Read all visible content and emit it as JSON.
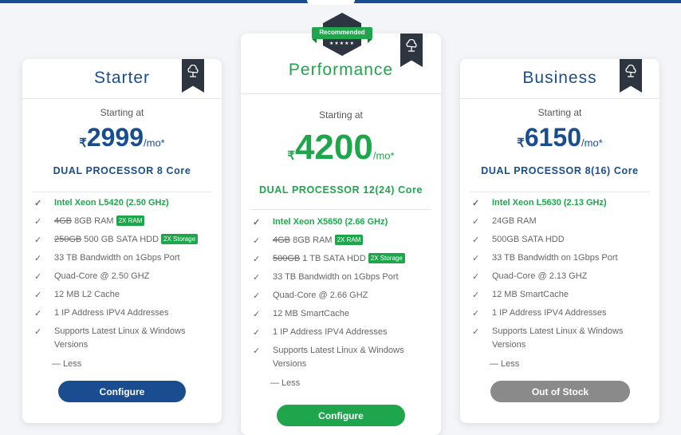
{
  "plans": [
    {
      "title": "Starter",
      "starting": "Starting at",
      "currency": "₹",
      "price": "2999",
      "per": "/mo*",
      "processor": "DUAL PROCESSOR 8 Core",
      "cpu": "Intel Xeon L5420 (2.50 GHz)",
      "ram_old": "4GB",
      "ram_new": " 8GB RAM",
      "ram_badge": "2X RAM",
      "hdd_old": "250GB",
      "hdd_new": " 500 GB SATA HDD",
      "hdd_badge": "2X Storage",
      "bandwidth": "33 TB Bandwidth on 1Gbps Port",
      "cores": "Quad-Core @ 2.50 GHZ",
      "cache": "12 MB L2 Cache",
      "ip": "1 IP Address IPV4 Addresses",
      "os": "Supports Latest Linux & Windows Versions",
      "less": "— Less",
      "button": "Configure"
    },
    {
      "title": "Performance",
      "starting": "Starting at",
      "currency": "₹",
      "price": "4200",
      "per": "/mo*",
      "processor": "DUAL PROCESSOR 12(24) Core",
      "cpu": "Intel Xeon X5650 (2.66 GHz)",
      "ram_old": "4GB",
      "ram_new": " 8GB RAM",
      "ram_badge": "2X RAM",
      "hdd_old": "500GB",
      "hdd_new": " 1 TB SATA HDD",
      "hdd_badge": "2X Storage",
      "bandwidth": "33 TB Bandwidth on 1Gbps Port",
      "cores": "Quad-Core @ 2.66 GHZ",
      "cache": "12 MB SmartCache",
      "ip": "1 IP Address IPV4 Addresses",
      "os": "Supports Latest Linux & Windows Versions",
      "less": "— Less",
      "button": "Configure",
      "recommended": "Recommended",
      "stars": "★★★★★"
    },
    {
      "title": "Business",
      "starting": "Starting at",
      "currency": "₹",
      "price": "6150",
      "per": "/mo*",
      "processor": "DUAL PROCESSOR 8(16) Core",
      "cpu": "Intel Xeon L5630 (2.13 GHz)",
      "ram": "24GB RAM",
      "hdd": "500GB SATA HDD",
      "bandwidth": "33 TB Bandwidth on 1Gbps Port",
      "cores": "Quad-Core @ 2.13 GHZ",
      "cache": "12 MB SmartCache",
      "ip": "1 IP Address IPV4 Addresses",
      "os": "Supports Latest Linux & Windows Versions",
      "less": "— Less",
      "button": "Out of Stock"
    }
  ],
  "check_glyph": "✓",
  "icons": {
    "plan": "cloud-server-icon",
    "check": "check-icon"
  },
  "colors": {
    "blue": "#1a4d8f",
    "green": "#1fa64d",
    "gray": "#8a8a8a",
    "ribbon": "#2d3640"
  }
}
